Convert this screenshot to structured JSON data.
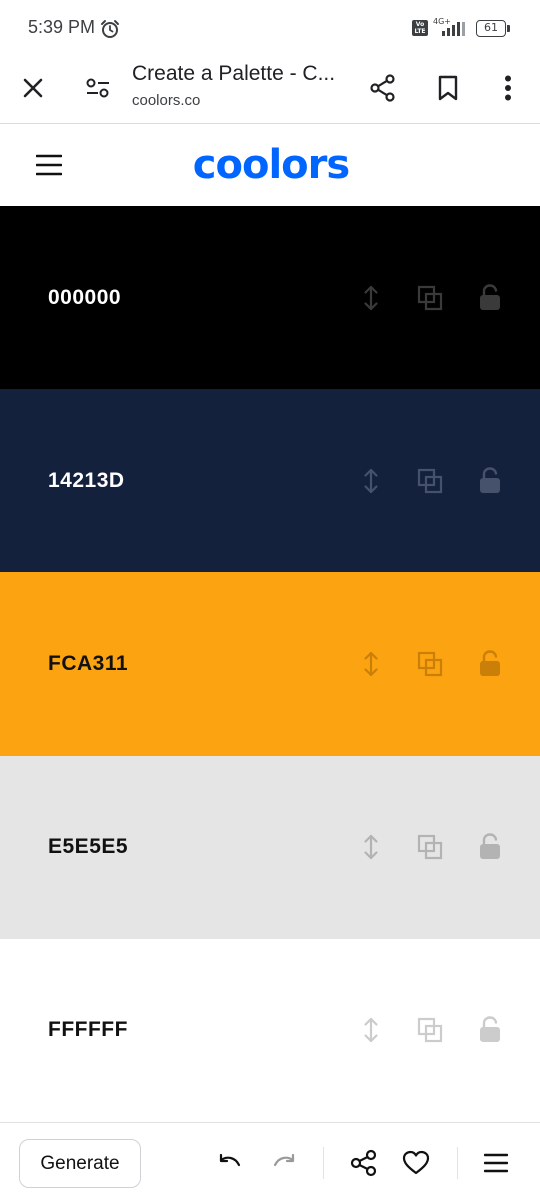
{
  "status_bar": {
    "time": "5:39 PM",
    "network": "4G+",
    "volte": "Vo LTE",
    "battery": "61"
  },
  "browser": {
    "page_title": "Create a Palette - C...",
    "url": "coolors.co"
  },
  "site": {
    "logo_text": "coolors",
    "brand_color": "#0066ff"
  },
  "palette": {
    "colors": [
      {
        "hex": "000000",
        "background": "#000000",
        "text_color": "#ffffff",
        "tool_color": "#3a3a3a"
      },
      {
        "hex": "14213D",
        "background": "#14213d",
        "text_color": "#ffffff",
        "tool_color": "#46516b"
      },
      {
        "hex": "FCA311",
        "background": "#fca311",
        "text_color": "#111111",
        "tool_color": "#c97f08"
      },
      {
        "hex": "E5E5E5",
        "background": "#e5e5e5",
        "text_color": "#111111",
        "tool_color": "#b3b3b3"
      },
      {
        "hex": "FFFFFF",
        "background": "#ffffff",
        "text_color": "#111111",
        "tool_color": "#cccccc"
      }
    ],
    "tool_icons": [
      "drag-icon",
      "copy-icon",
      "lock-icon"
    ]
  },
  "bottom_bar": {
    "generate_label": "Generate"
  }
}
